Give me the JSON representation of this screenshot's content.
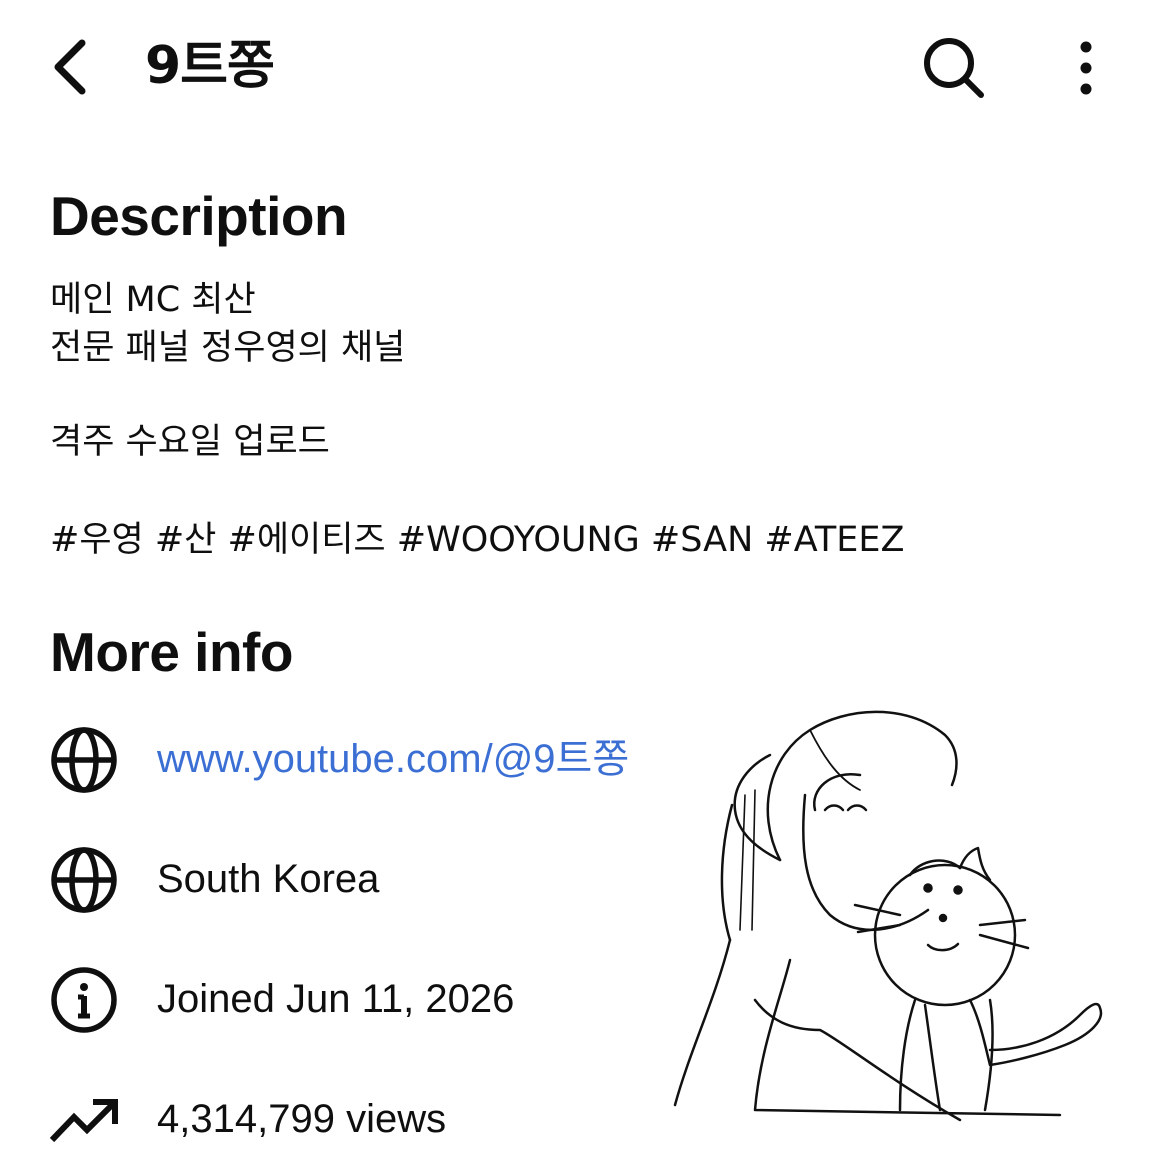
{
  "header": {
    "title": "9트쫑",
    "back_icon": "chevron-left-icon",
    "search_icon": "search-icon",
    "more_icon": "more-vertical-icon"
  },
  "description": {
    "heading": "Description",
    "lines": [
      "메인 MC 최산",
      "전문 패널 정우영의 채널",
      "격주 수요일 업로드",
      "#우영 #산 #에이티즈 #WOOYOUNG #SAN #ATEEZ"
    ]
  },
  "more_info": {
    "heading": "More info",
    "items": [
      {
        "icon": "globe-icon",
        "text": "www.youtube.com/@9트쫑",
        "type": "link"
      },
      {
        "icon": "globe-icon",
        "text": "South Korea",
        "type": "text"
      },
      {
        "icon": "info-icon",
        "text": "Joined Jun 11, 2026",
        "type": "text"
      },
      {
        "icon": "trending-up-icon",
        "text": "4,314,799 views",
        "type": "text"
      }
    ]
  },
  "colors": {
    "link": "#3b6fd4",
    "text": "#0f0f0f",
    "background": "#ffffff"
  }
}
